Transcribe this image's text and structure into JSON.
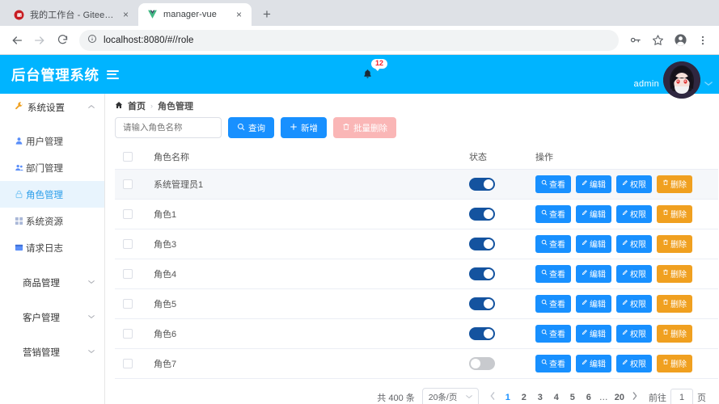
{
  "browser": {
    "tabs": [
      {
        "title": "我的工作台 - Gitee.com",
        "favicon": "gitee-icon",
        "active": false
      },
      {
        "title": "manager-vue",
        "favicon": "vue-icon",
        "active": true
      }
    ],
    "newtab_label": "+",
    "close_label": "×",
    "back_icon": "back-arrow-icon",
    "forward_icon": "forward-arrow-icon",
    "reload_icon": "reload-icon",
    "url": "localhost:8080/#//role",
    "site_info_icon": "info-circle-icon",
    "toolbar_icons": [
      "key-icon",
      "star-icon",
      "profile-icon",
      "kebab-menu-icon"
    ]
  },
  "app": {
    "brand": "后台管理系统",
    "menu_toggle_icon": "hamburger-icon",
    "notification_count": "12",
    "bell_icon": "bell-icon",
    "user_name": "admin",
    "user_caret_icon": "chevron-down-icon",
    "accent_color": "#00b4ff"
  },
  "sidebar": {
    "group": {
      "label": "系统设置",
      "icon": "wrench-icon",
      "chevron": "chevron-up-icon"
    },
    "items": [
      {
        "label": "用户管理",
        "icon": "user-icon",
        "active": false
      },
      {
        "label": "部门管理",
        "icon": "group-icon",
        "active": false
      },
      {
        "label": "角色管理",
        "icon": "lock-icon",
        "active": true
      },
      {
        "label": "系统资源",
        "icon": "grid-icon",
        "active": false
      },
      {
        "label": "请求日志",
        "icon": "window-icon",
        "active": false
      }
    ],
    "collapsed_groups": [
      {
        "label": "商品管理",
        "chevron": "chevron-down-icon"
      },
      {
        "label": "客户管理",
        "chevron": "chevron-down-icon"
      },
      {
        "label": "营销管理",
        "chevron": "chevron-down-icon"
      }
    ]
  },
  "breadcrumb": {
    "home_icon": "home-icon",
    "home": "首页",
    "separator": "›",
    "current": "角色管理"
  },
  "toolbar": {
    "search_placeholder": "请输入角色名称",
    "search_value": "",
    "query_label": "查询",
    "query_icon": "search-icon",
    "add_label": "新增",
    "add_icon": "plus-icon",
    "batch_delete_label": "批量删除",
    "batch_delete_icon": "trash-icon",
    "batch_delete_disabled": true
  },
  "table": {
    "columns": [
      "",
      "角色名称",
      "状态",
      "操作"
    ],
    "ops": [
      {
        "label": "查看",
        "icon": "search-icon",
        "style": "blue"
      },
      {
        "label": "编辑",
        "icon": "pencil-icon",
        "style": "blue"
      },
      {
        "label": "权限",
        "icon": "pencil-icon",
        "style": "blue"
      },
      {
        "label": "删除",
        "icon": "trash-icon",
        "style": "orange"
      }
    ],
    "rows": [
      {
        "name": "系统管理员1",
        "status": true,
        "checked": false,
        "hover": true
      },
      {
        "name": "角色1",
        "status": true,
        "checked": false,
        "hover": false
      },
      {
        "name": "角色3",
        "status": true,
        "checked": false,
        "hover": false
      },
      {
        "name": "角色4",
        "status": true,
        "checked": false,
        "hover": false
      },
      {
        "name": "角色5",
        "status": true,
        "checked": false,
        "hover": false
      },
      {
        "name": "角色6",
        "status": true,
        "checked": false,
        "hover": false
      },
      {
        "name": "角色7",
        "status": false,
        "checked": false,
        "hover": false
      }
    ]
  },
  "pagination": {
    "total_text": "共 400 条",
    "page_size_text": "20条/页",
    "prev_icon": "chevron-left-icon",
    "next_icon": "chevron-right-icon",
    "pages": [
      "1",
      "2",
      "3",
      "4",
      "5",
      "6"
    ],
    "ellipsis": "…",
    "last_page": "20",
    "current_page": "1",
    "jump_prefix": "前往",
    "jump_value": "1",
    "jump_suffix": "页"
  }
}
